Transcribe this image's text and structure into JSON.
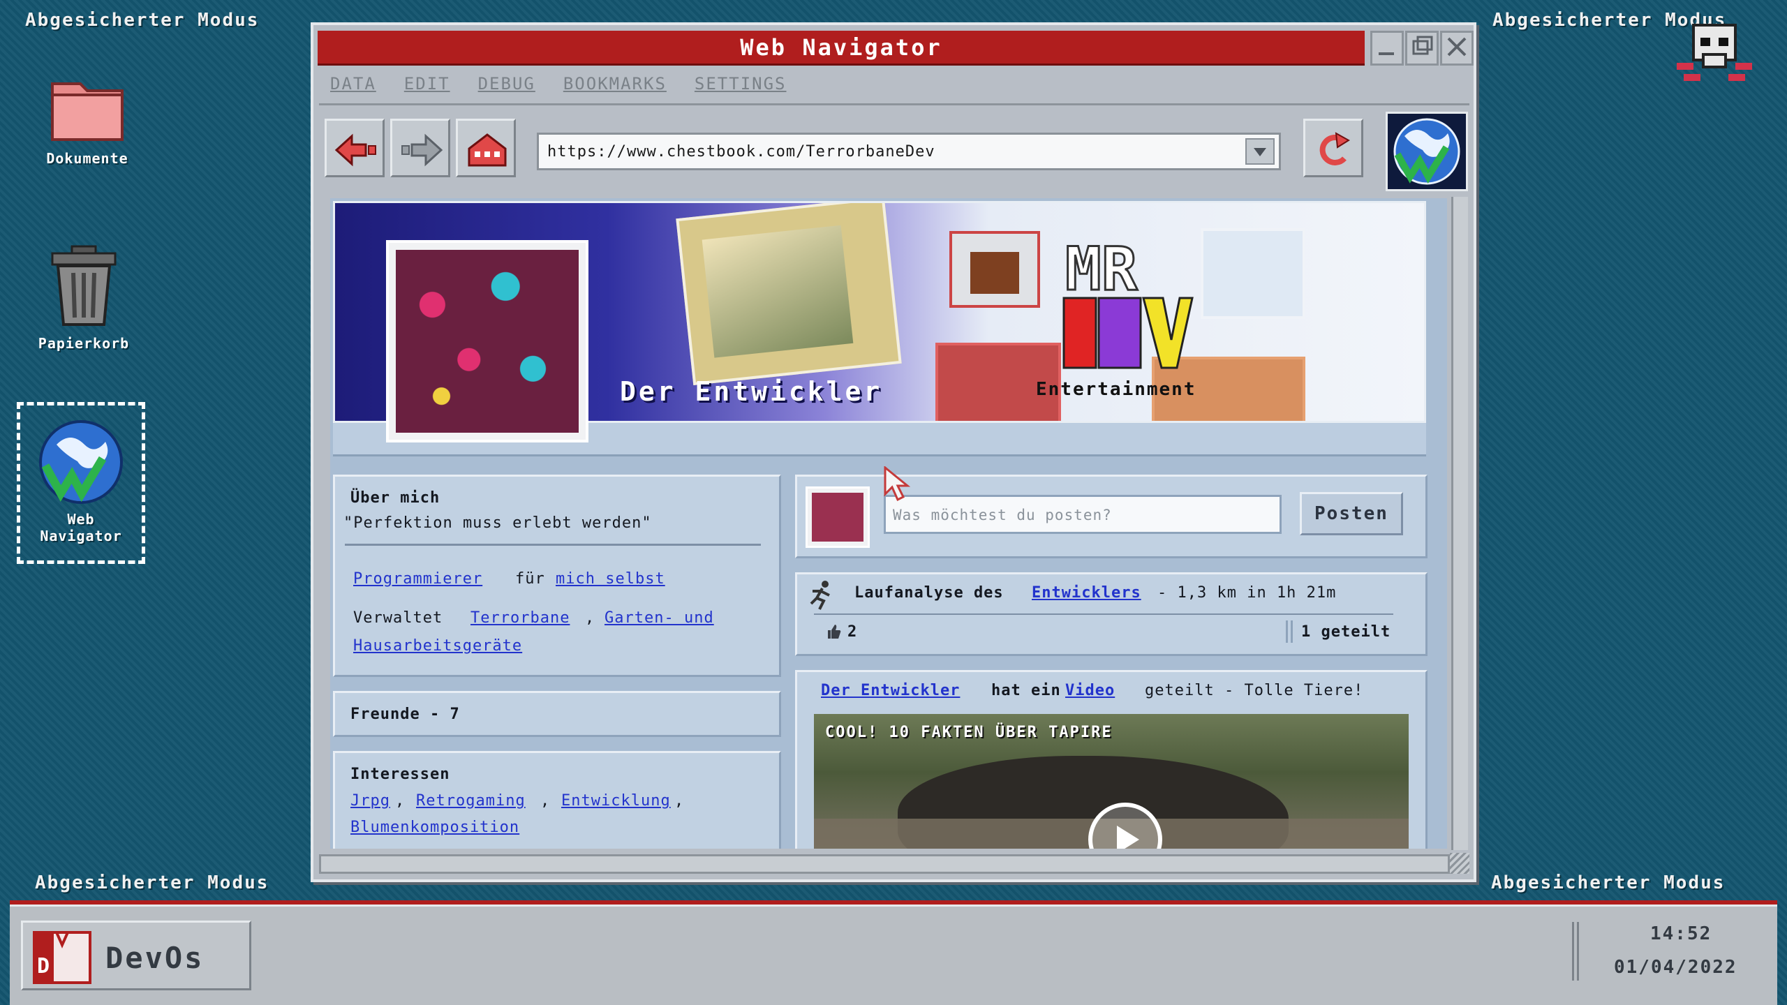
{
  "safe_mode_label": "Abgesicherter Modus",
  "desktop": {
    "icons": [
      {
        "label": "Dokumente"
      },
      {
        "label": "Papierkorb"
      },
      {
        "label": "Web\nNavigator"
      }
    ]
  },
  "window": {
    "title": "Web Navigator",
    "menu": [
      "DATA",
      "EDIT",
      "DEBUG",
      "BOOKMARKS",
      "SETTINGS"
    ],
    "url": "https://www.chestbook.com/TerrorbaneDev"
  },
  "profile": {
    "name": "Der Entwickler",
    "brand_caption": "Entertainment",
    "brand_logo_text": "MR DEV",
    "about": {
      "heading": "Über mich",
      "quote": "\"Perfektion muss erlebt werden\"",
      "role_link": "Programmierer",
      "role_mid": "für",
      "role_link2": "mich selbst",
      "manages_label": "Verwaltet",
      "manages_link1": "Terrorbane",
      "manages_sep": ",",
      "manages_link2a": "Garten- und",
      "manages_link2b": "Hausarbeitsgeräte"
    },
    "friends_label": "Freunde - 7",
    "interests": {
      "heading": "Interessen",
      "items": [
        "Jrpg",
        "Retrogaming",
        "Entwicklung",
        "Blumenkomposition"
      ]
    }
  },
  "composer": {
    "placeholder": "Was möchtest du posten?",
    "button": "Posten"
  },
  "posts": {
    "run": {
      "prefix": "Laufanalyse des",
      "link": "Entwicklers",
      "suffix": "- 1,3 km in 1h 21m",
      "likes": "2",
      "shares": "1 geteilt"
    },
    "video": {
      "author": "Der Entwickler",
      "mid": "hat ein",
      "link": "Video",
      "suffix": "geteilt - Tolle Tiere!",
      "title": "COOL! 10 FAKTEN ÜBER TAPIRE"
    }
  },
  "taskbar": {
    "start_label": "DevOs",
    "time": "14:52",
    "date": "01/04/2022"
  }
}
